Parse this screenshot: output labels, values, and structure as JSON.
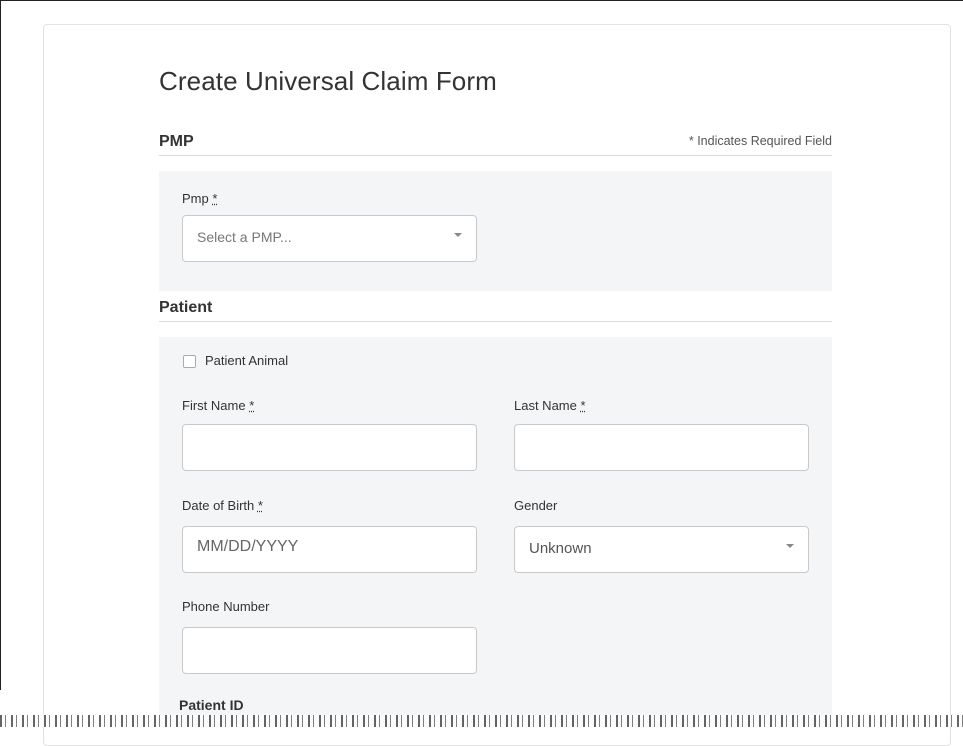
{
  "page": {
    "title": "Create Universal Claim Form"
  },
  "pmp_section": {
    "heading": "PMP",
    "required_note": "* Indicates Required Field",
    "pmp_label": "Pmp",
    "required_mark": "*",
    "pmp_placeholder": "Select a PMP..."
  },
  "patient_section": {
    "heading": "Patient",
    "patient_animal_label": "Patient Animal",
    "first_name_label": "First Name",
    "last_name_label": "Last Name",
    "dob_label": "Date of Birth",
    "dob_placeholder": "MM/DD/YYYY",
    "gender_label": "Gender",
    "gender_value": "Unknown",
    "phone_label": "Phone Number",
    "patient_id_label": "Patient ID",
    "required_mark": "*"
  },
  "icons": {
    "dropdown": "chevron-down-icon",
    "checkbox": "checkbox-icon"
  },
  "colors": {
    "section_bg": "#f4f5f6",
    "border": "#c9c9c9",
    "text": "#333333"
  }
}
